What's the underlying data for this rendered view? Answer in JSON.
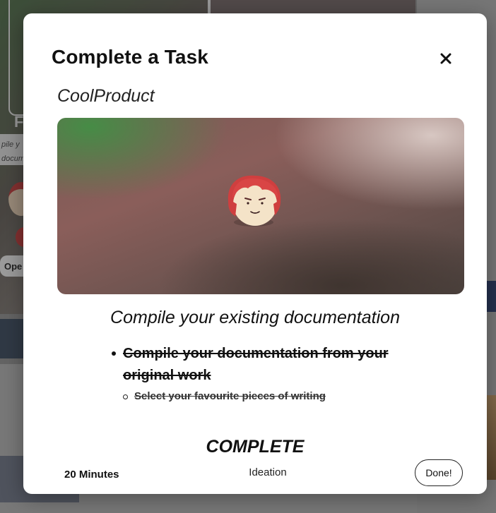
{
  "modal": {
    "title": "Complete a Task",
    "close_icon": "close-icon",
    "product_name": "CoolProduct",
    "hero_icon": "avatar-red-hair-icon",
    "task_heading": "Compile your existing documentation",
    "tasks": [
      {
        "label": "Compile your documentation from your original work",
        "done": true,
        "subtasks": [
          {
            "label": "Select your favourite pieces of writing",
            "done": true
          }
        ]
      }
    ],
    "status": "COMPLETE",
    "duration": "20 Minutes",
    "category": "Ideation",
    "done_button": "Done!"
  },
  "background": {
    "left_open_button": "Ope",
    "left_card_letter": "F",
    "left_snippet": "pile y\ndocum"
  },
  "colors": {
    "modal_bg": "#ffffff",
    "text": "#111111",
    "overlay": "rgba(0,0,0,0.35)"
  }
}
